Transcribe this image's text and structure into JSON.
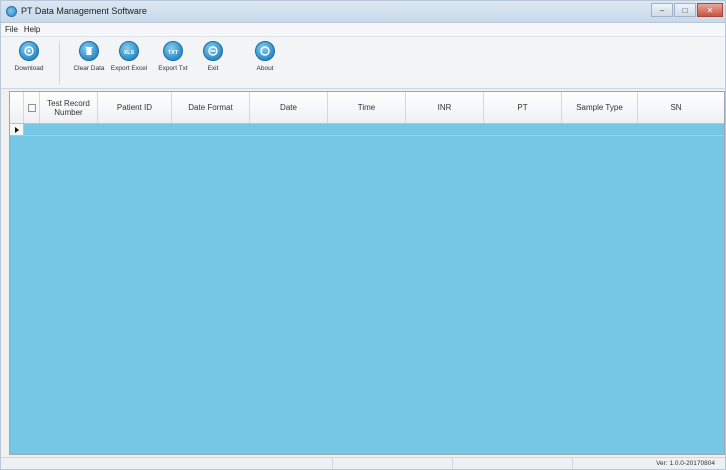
{
  "window": {
    "title": "PT Data Management Software"
  },
  "menu": {
    "items": [
      "File",
      "Help"
    ]
  },
  "toolbar": {
    "buttons": [
      {
        "label": "Download",
        "icon": "download-icon"
      },
      {
        "label": "Clear Data",
        "icon": "trash-icon"
      },
      {
        "label": "Export Excel",
        "icon": "xls-icon"
      },
      {
        "label": "Export Txt",
        "icon": "txt-icon"
      },
      {
        "label": "Exit",
        "icon": "exit-icon"
      },
      {
        "label": "About",
        "icon": "info-icon"
      }
    ]
  },
  "grid": {
    "columns": [
      "Test Record Number",
      "Patient ID",
      "Date Format",
      "Date",
      "Time",
      "INR",
      "PT",
      "Sample Type",
      "SN"
    ],
    "background": "#76c6e6"
  },
  "statusbar": {
    "version": "Ver: 1.0.0-20170804"
  }
}
